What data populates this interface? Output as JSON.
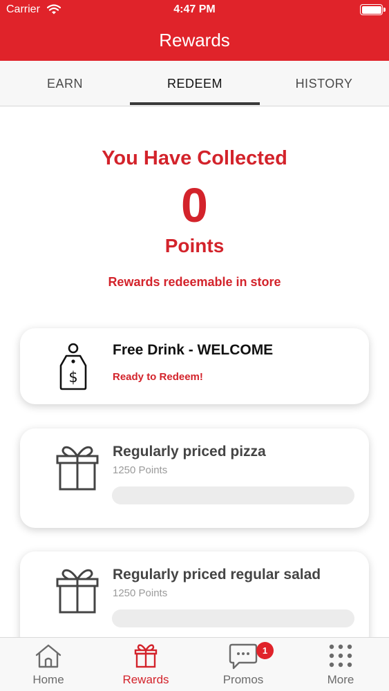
{
  "status_bar": {
    "carrier": "Carrier",
    "time": "4:47 PM"
  },
  "header": {
    "title": "Rewards"
  },
  "tabs": [
    {
      "label": "EARN",
      "active": false
    },
    {
      "label": "REDEEM",
      "active": true
    },
    {
      "label": "HISTORY",
      "active": false
    }
  ],
  "summary": {
    "heading": "You Have Collected",
    "points": "0",
    "points_label": "Points",
    "note": "Rewards redeemable in store"
  },
  "rewards": [
    {
      "title": "Free Drink - WELCOME",
      "status": "Ready to Redeem!",
      "icon": "price-tag-icon"
    },
    {
      "title": "Regularly priced pizza",
      "points": "1250 Points",
      "progress": 0,
      "icon": "gift-icon"
    },
    {
      "title": "Regularly priced regular salad",
      "points": "1250 Points",
      "progress": 0,
      "icon": "gift-icon"
    }
  ],
  "bottom_nav": [
    {
      "label": "Home",
      "icon": "home-icon",
      "active": false
    },
    {
      "label": "Rewards",
      "icon": "gift-icon",
      "active": true
    },
    {
      "label": "Promos",
      "icon": "chat-bubble-icon",
      "active": false,
      "badge": "1"
    },
    {
      "label": "More",
      "icon": "grid-dots-icon",
      "active": false
    }
  ],
  "colors": {
    "brand_red": "#e0232a",
    "text_red": "#d3232b"
  }
}
